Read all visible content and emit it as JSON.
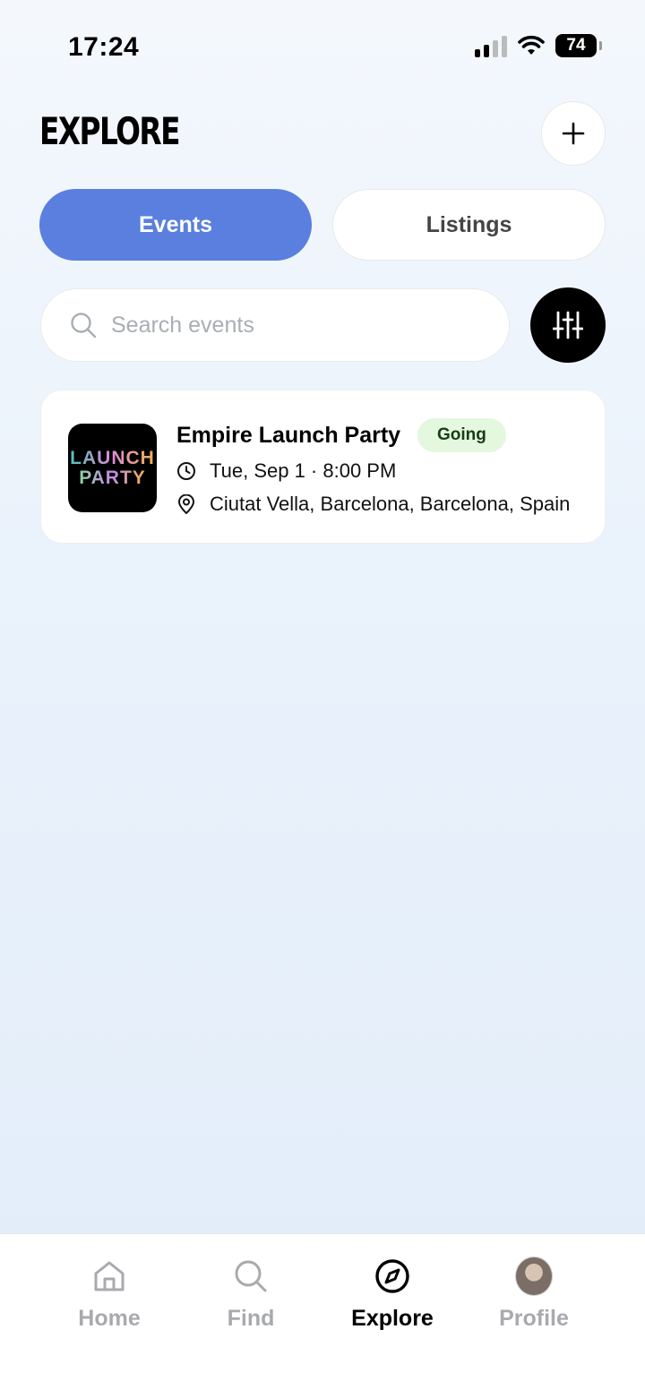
{
  "status_bar": {
    "time": "17:24",
    "battery": "74",
    "icons": [
      "cellular-signal-icon",
      "wifi-icon",
      "battery-icon"
    ]
  },
  "header": {
    "title": "EXPLORE",
    "add_icon": "plus-icon"
  },
  "tabs": [
    {
      "label": "Events",
      "active": true
    },
    {
      "label": "Listings",
      "active": false
    }
  ],
  "search": {
    "placeholder": "Search events",
    "icon": "search-icon",
    "filter_icon": "sliders-icon"
  },
  "events": [
    {
      "title": "Empire Launch Party",
      "badge": "Going",
      "thumbnail_text": [
        "LAUNCH",
        "PARTY"
      ],
      "date": "Tue, Sep 1 · 8:00 PM",
      "location": "Ciutat Vella, Barcelona, Barcelona, Spain"
    }
  ],
  "nav": {
    "items": [
      {
        "label": "Home",
        "icon": "home-icon",
        "active": false
      },
      {
        "label": "Find",
        "icon": "search-icon",
        "active": false
      },
      {
        "label": "Explore",
        "icon": "compass-icon",
        "active": true
      },
      {
        "label": "Profile",
        "icon": "avatar",
        "active": false
      }
    ]
  },
  "colors": {
    "accent": "#5a7fde",
    "badge_bg": "#e4f7df",
    "nav_inactive": "#a9aaae"
  }
}
